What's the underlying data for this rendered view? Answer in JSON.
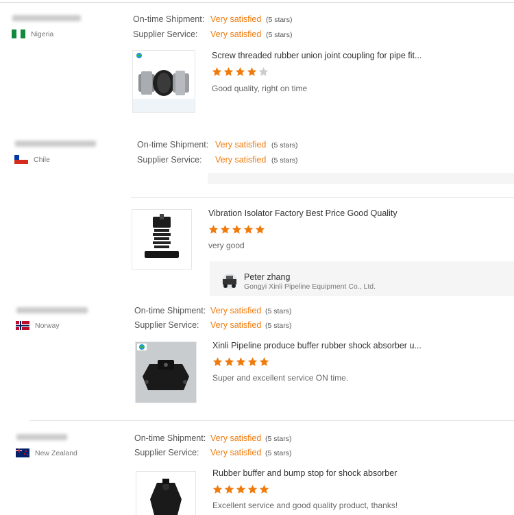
{
  "colors": {
    "accent": "#f07b0d",
    "star_filled": "#f07b0d",
    "star_empty": "#cccccc"
  },
  "labels": {
    "on_time": "On-time Shipment:",
    "supplier": "Supplier Service:",
    "very_satisfied": "Very satisfied",
    "five_stars": "(5 stars)"
  },
  "reviews": [
    {
      "country": "Nigeria",
      "flag": "nigeria-flag",
      "product": "Screw threaded rubber union joint coupling for pipe fit...",
      "rating": 4,
      "comment": "Good quality, right on time"
    },
    {
      "country": "Chile",
      "flag": "chile-flag"
    },
    {
      "product": "Vibration Isolator Factory Best Price Good Quality",
      "rating": 5,
      "comment": "very good",
      "reply": {
        "name": "Peter zhang",
        "company": "Gongyi Xinli Pipeline Equipment Co., Ltd."
      }
    },
    {
      "country": "Norway",
      "flag": "norway-flag",
      "product": "Xinli Pipeline produce buffer rubber shock absorber u...",
      "rating": 5,
      "comment": "Super and excellent service ON time."
    },
    {
      "country": "New Zealand",
      "flag": "new-zealand-flag",
      "product": "Rubber buffer and bump stop for shock absorber",
      "rating": 5,
      "comment": "Excellent service and good quality product, thanks!"
    }
  ]
}
